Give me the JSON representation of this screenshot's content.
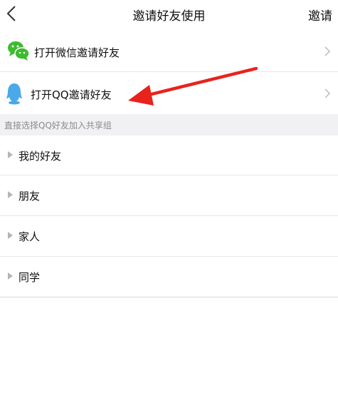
{
  "nav": {
    "back_icon": "chevron-left-icon",
    "title": "邀请好友使用",
    "action": "邀请"
  },
  "invite_options": [
    {
      "icon": "wechat-icon",
      "label": "打开微信邀请好友"
    },
    {
      "icon": "qq-icon",
      "label": "打开QQ邀请好友"
    }
  ],
  "section": {
    "header": "直接选择QQ好友加入共享组"
  },
  "groups": [
    {
      "label": "我的好友"
    },
    {
      "label": "朋友"
    },
    {
      "label": "家人"
    },
    {
      "label": "同学"
    }
  ],
  "annotation": {
    "arrow_color": "#e8231b"
  },
  "colors": {
    "wechat_green": "#3dbb2f",
    "qq_blue": "#4aa9e8"
  }
}
